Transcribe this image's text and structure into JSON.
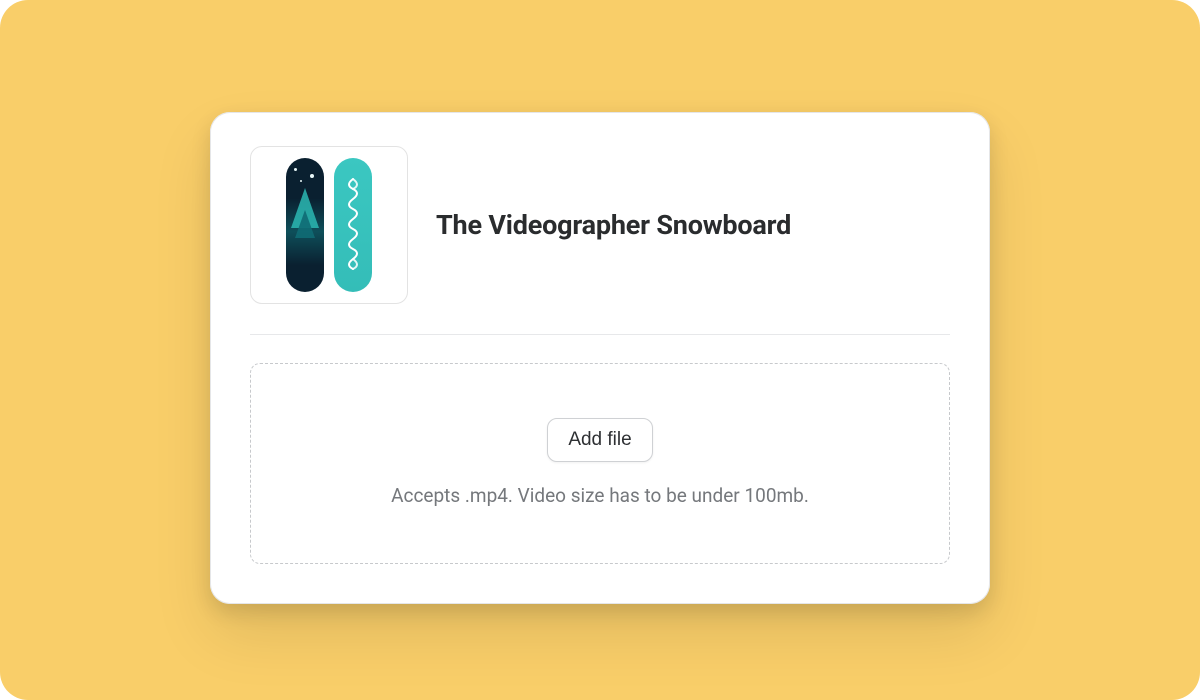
{
  "product": {
    "title": "The Videographer Snowboard",
    "image_alt": "snowboard-thumbnail"
  },
  "upload": {
    "button_label": "Add file",
    "hint": "Accepts .mp4. Video size has to be under 100mb."
  }
}
